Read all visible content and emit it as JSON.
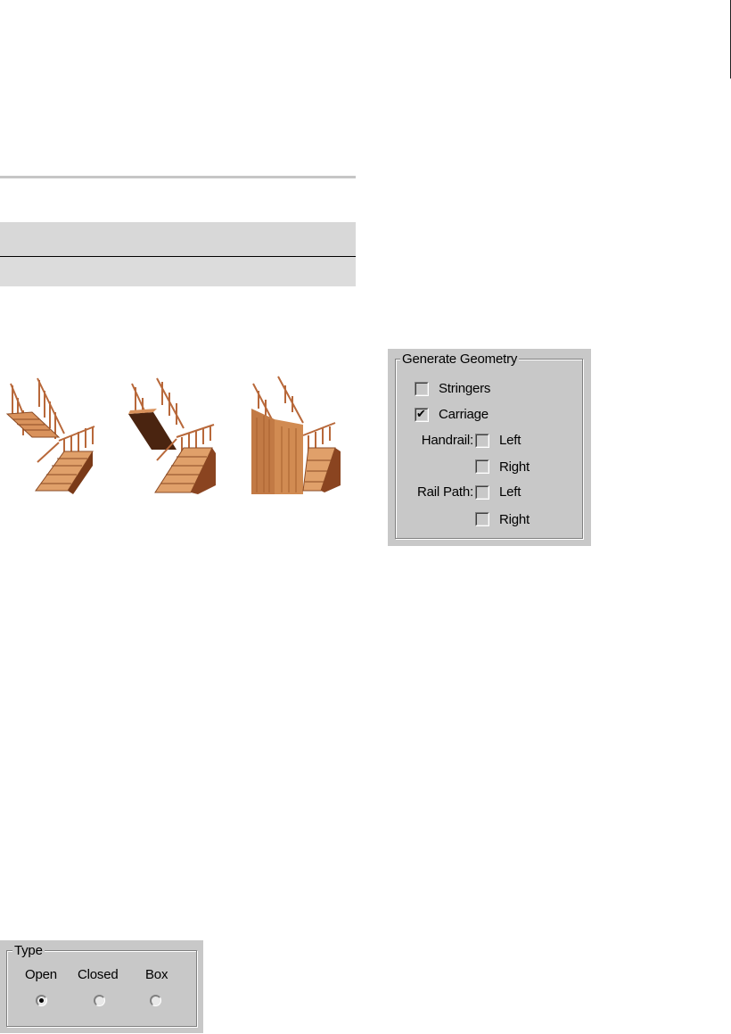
{
  "geometry_panel": {
    "title": "Generate Geometry",
    "stringers": {
      "label": "Stringers",
      "checked": false
    },
    "carriage": {
      "label": "Carriage",
      "checked": true
    },
    "handrail": {
      "label": "Handrail:",
      "left": {
        "label": "Left",
        "checked": false
      },
      "right": {
        "label": "Right",
        "checked": false
      }
    },
    "rail_path": {
      "label": "Rail Path:",
      "left": {
        "label": "Left",
        "checked": false
      },
      "right": {
        "label": "Right",
        "checked": false
      }
    },
    "check_glyph": "✔"
  },
  "type_panel": {
    "title": "Type",
    "options": [
      {
        "label": "Open",
        "selected": true
      },
      {
        "label": "Closed",
        "selected": false
      },
      {
        "label": "Box",
        "selected": false
      }
    ]
  },
  "illustrations": [
    {
      "name": "open-stairs",
      "color": "#d48a55"
    },
    {
      "name": "closed-stairs",
      "color": "#c77d47"
    },
    {
      "name": "box-stairs",
      "color": "#b86d3a"
    }
  ]
}
